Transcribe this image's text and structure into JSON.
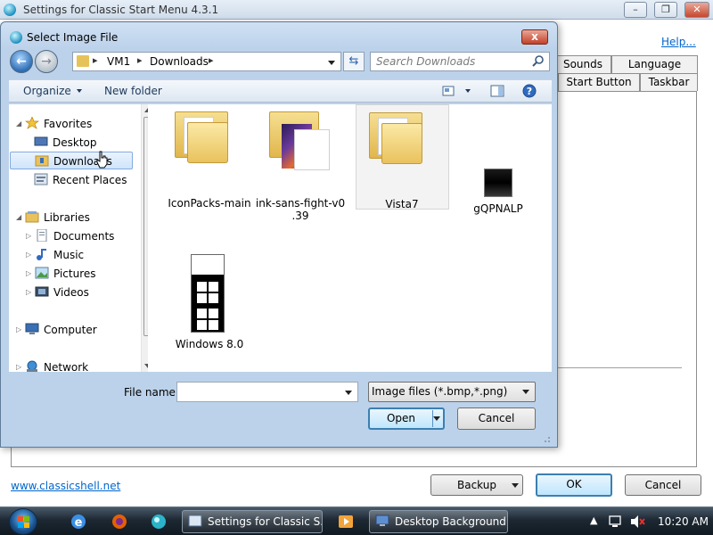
{
  "background_window": {
    "title": "Settings for Classic Start Menu 4.3.1",
    "help_link": "Help...",
    "tabs_row1": [
      "Sounds",
      "Language"
    ],
    "tabs_row2": [
      "Start Button",
      "Taskbar"
    ],
    "website_link": "www.classicshell.net",
    "buttons": {
      "backup": "Backup",
      "ok": "OK",
      "cancel": "Cancel"
    }
  },
  "dialog": {
    "title": "Select Image File",
    "close_glyph": "x",
    "address": {
      "segments": [
        "VM1",
        "Downloads"
      ]
    },
    "search": {
      "placeholder": "Search Downloads"
    },
    "toolbar": {
      "organize": "Organize",
      "new_folder": "New folder"
    },
    "nav": {
      "favorites": "Favorites",
      "desktop": "Desktop",
      "downloads": "Downloads",
      "recent_places": "Recent Places",
      "libraries": "Libraries",
      "documents": "Documents",
      "music": "Music",
      "pictures": "Pictures",
      "videos": "Videos",
      "computer": "Computer",
      "network": "Network"
    },
    "files": [
      {
        "name": "IconPacks-main",
        "type": "folder"
      },
      {
        "name_line1": "ink-sans-fight-v0",
        "name_line2": ".39",
        "type": "folder"
      },
      {
        "name": "Vista7",
        "type": "folder"
      },
      {
        "name": "gQPNALP",
        "type": "image"
      },
      {
        "name": "Windows 8.0",
        "type": "image"
      }
    ],
    "file_name_label": "File name:",
    "file_name_value": "",
    "filter": "Image files (*.bmp,*.png)",
    "open_button": "Open",
    "cancel_button": "Cancel"
  },
  "taskbar": {
    "tasks": [
      "Settings for Classic S...",
      "Desktop Background"
    ],
    "clock": "10:20 AM"
  }
}
